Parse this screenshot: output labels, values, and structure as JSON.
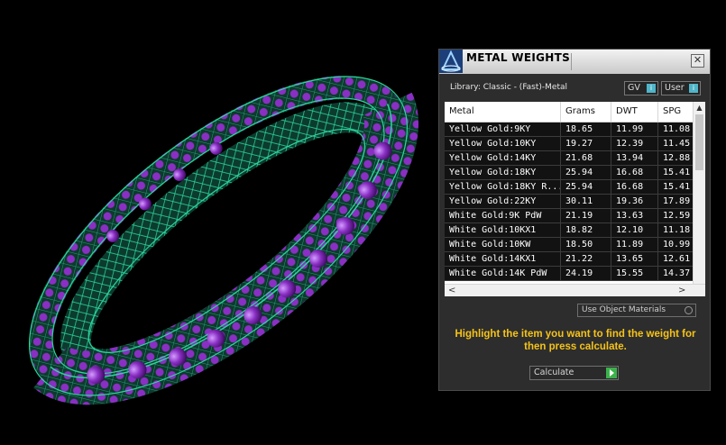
{
  "window": {
    "title": "METAL WEIGHTS",
    "close_label": "✕"
  },
  "library_label": "Library: Classic - (Fast)-Metal",
  "toggles": {
    "gv_label": "GV",
    "user_label": "User",
    "knob_label": "i"
  },
  "table": {
    "headers": [
      "Metal",
      "Grams",
      "DWT",
      "SPG"
    ],
    "rows": [
      [
        "Yellow Gold:9KY",
        "18.65",
        "11.99",
        "11.08"
      ],
      [
        "Yellow Gold:10KY",
        "19.27",
        "12.39",
        "11.45"
      ],
      [
        "Yellow Gold:14KY",
        "21.68",
        "13.94",
        "12.88"
      ],
      [
        "Yellow Gold:18KY",
        "25.94",
        "16.68",
        "15.41"
      ],
      [
        "Yellow Gold:18KY R...",
        "25.94",
        "16.68",
        "15.41"
      ],
      [
        "Yellow Gold:22KY",
        "30.11",
        "19.36",
        "17.89"
      ],
      [
        "White Gold:9K PdW",
        "21.19",
        "13.63",
        "12.59"
      ],
      [
        "White Gold:10KX1",
        "18.82",
        "12.10",
        "11.18"
      ],
      [
        "White Gold:10KW",
        "18.50",
        "11.89",
        "10.99"
      ],
      [
        "White Gold:14KX1",
        "21.22",
        "13.65",
        "12.61"
      ],
      [
        "White Gold:14K PdW",
        "24.19",
        "15.55",
        "14.37"
      ]
    ]
  },
  "use_object_materials_label": "Use Object Materials",
  "instructions": "Highlight the item you want to find the weight for then press calculate.",
  "calculate_label": "Calculate",
  "colors": {
    "wire": "#1f9c78",
    "gem": "#8a2fc4",
    "text_highlight": "#f5c318"
  }
}
